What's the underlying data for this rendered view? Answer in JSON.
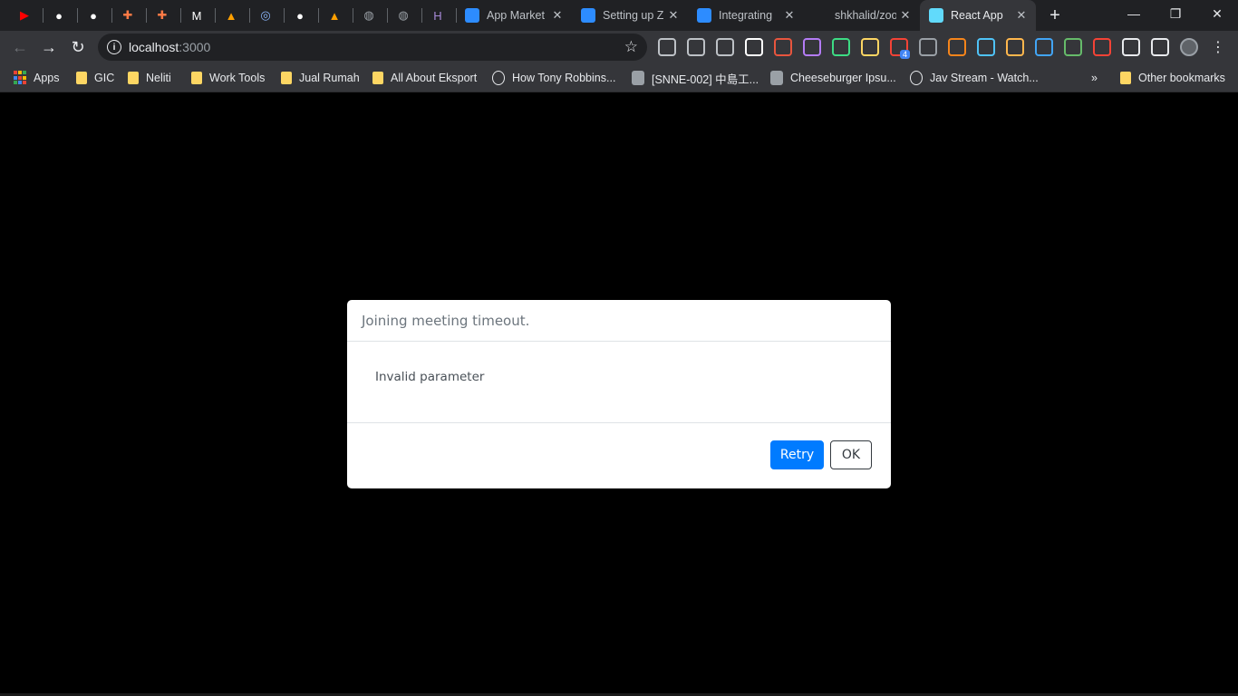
{
  "tabs": {
    "pinned": [
      {
        "icon": "youtube-icon",
        "glyph": "▶",
        "color": "#ff0000"
      },
      {
        "icon": "github-icon",
        "glyph": "●",
        "color": "#ffffff"
      },
      {
        "icon": "github-icon",
        "glyph": "●",
        "color": "#ffffff"
      },
      {
        "icon": "sparkle-icon",
        "glyph": "✚",
        "color": "#ff7a45"
      },
      {
        "icon": "sparkle-icon",
        "glyph": "✚",
        "color": "#ff7a45"
      },
      {
        "icon": "medium-icon",
        "glyph": "M",
        "color": "#ffffff"
      },
      {
        "icon": "firebase-icon",
        "glyph": "▲",
        "color": "#ffa000"
      },
      {
        "icon": "target-icon",
        "glyph": "◎",
        "color": "#8ab4f8"
      },
      {
        "icon": "github-icon",
        "glyph": "●",
        "color": "#ffffff"
      },
      {
        "icon": "firebase-icon",
        "glyph": "▲",
        "color": "#ffa000"
      },
      {
        "icon": "globe-icon",
        "glyph": "◍",
        "color": "#9aa0a6"
      },
      {
        "icon": "globe-icon",
        "glyph": "◍",
        "color": "#9aa0a6"
      },
      {
        "icon": "heroku-icon",
        "glyph": "H",
        "color": "#a88ad8"
      }
    ],
    "open": [
      {
        "title": "App Market",
        "favicon": "zoom-icon",
        "color": "#2d8cff"
      },
      {
        "title": "Setting up Z",
        "favicon": "zoom-icon",
        "color": "#2d8cff"
      },
      {
        "title": "Integrating",
        "favicon": "zoom-icon",
        "color": "#2d8cff"
      },
      {
        "title": "shkhalid/zoo",
        "favicon": "github-icon",
        "color": "#202124"
      },
      {
        "title": "React App",
        "favicon": "react-icon",
        "color": "#61dafb"
      }
    ]
  },
  "window_controls": {
    "minimize": "—",
    "restore": "❐",
    "close": "✕"
  },
  "toolbar": {
    "back": "←",
    "forward": "→",
    "reload": "↻",
    "url_host": "localhost",
    "url_port": ":3000",
    "info_glyph": "i",
    "star": "☆"
  },
  "extensions": [
    {
      "icon": "extension-1-icon",
      "color": "#bdc1c6"
    },
    {
      "icon": "vue-icon",
      "color": "#bdc1c6"
    },
    {
      "icon": "record-icon",
      "color": "#bdc1c6"
    },
    {
      "icon": "chatbot-icon",
      "color": "#ffffff"
    },
    {
      "icon": "droplet-icon",
      "color": "#e8553e"
    },
    {
      "icon": "pen-icon",
      "color": "#b47cf5"
    },
    {
      "icon": "cursor-icon",
      "color": "#3ddc84"
    },
    {
      "icon": "folder-ext-icon",
      "color": "#fdd663"
    },
    {
      "icon": "lighthouse-icon",
      "color": "#f44336"
    },
    {
      "icon": "code-c-icon",
      "color": "#9aa0a6"
    },
    {
      "icon": "metamask-icon",
      "color": "#f6851b"
    },
    {
      "icon": "grid-icon",
      "color": "#4fc3f7"
    },
    {
      "icon": "flag-icon",
      "color": "#ffb74d"
    },
    {
      "icon": "window-icon",
      "color": "#42a5f5"
    },
    {
      "icon": "pie-icon",
      "color": "#66bb6a"
    },
    {
      "icon": "code-brackets-icon",
      "color": "#f44336"
    },
    {
      "icon": "puzzle-icon",
      "color": "#e8eaed"
    },
    {
      "icon": "media-icon",
      "color": "#e8eaed"
    },
    {
      "icon": "avatar-icon",
      "color": "#9aa0a6"
    },
    {
      "icon": "menu-icon",
      "color": "#e8eaed"
    }
  ],
  "lighthouse_badge": "4",
  "bookmarks": [
    {
      "label": "Apps",
      "type": "apps"
    },
    {
      "label": "GIC",
      "type": "folder"
    },
    {
      "label": "Neliti",
      "type": "folder"
    },
    {
      "label": "Work Tools",
      "type": "folder"
    },
    {
      "label": "Jual Rumah",
      "type": "folder"
    },
    {
      "label": "All About Eksport",
      "type": "folder"
    },
    {
      "label": "How Tony Robbins...",
      "type": "globe"
    },
    {
      "label": "[SNNE-002] 中島工...",
      "type": "site"
    },
    {
      "label": "Cheeseburger Ipsu...",
      "type": "site"
    },
    {
      "label": "Jav Stream - Watch...",
      "type": "globe"
    }
  ],
  "bookmarks_overflow": "»",
  "other_bookmarks": "Other bookmarks",
  "dialog": {
    "title": "Joining meeting timeout.",
    "message": "Invalid parameter",
    "retry_label": "Retry",
    "ok_label": "OK",
    "accent": "#007bff"
  }
}
